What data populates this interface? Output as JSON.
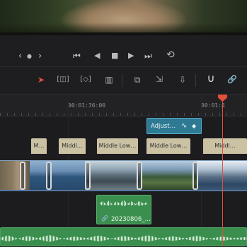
{
  "transport": {
    "prev_label": "‹",
    "dot_label": "●",
    "next_label": "›",
    "first_frame": "⏮",
    "reverse": "◀",
    "stop": "■",
    "play": "▶",
    "last_frame": "⏭",
    "loop": "⟲"
  },
  "toolbar": {
    "select_icon": "➤",
    "trim_icon": "[◫]",
    "dynamic_trim_icon": "[◇]",
    "blade_icon": "▥",
    "insert_icon": "⧉",
    "overwrite_icon": "⇲",
    "replace_icon": "⇩",
    "snap_icon": "∪",
    "link_icon": "🔗"
  },
  "ruler": {
    "timecode_1": "00:01:36:00",
    "timecode_2": "00:01:4"
  },
  "adjustment_clip": {
    "label": "Adjust…",
    "curve_icon": "∿",
    "keyframe_icon": "◆"
  },
  "title_clips": [
    {
      "label": "M…"
    },
    {
      "label": "Middl…"
    },
    {
      "label": "Middle Low…"
    },
    {
      "label": "Middle Low…"
    },
    {
      "label": "Middl…"
    }
  ],
  "audio_clip": {
    "label": "20230806_…",
    "link_icon": "🔗"
  },
  "colors": {
    "playhead": "#e2503b",
    "adjustment": "#2f7a93",
    "audio": "#3b8f4e",
    "title": "#cbc2a4",
    "video_border": "#5577a0"
  }
}
